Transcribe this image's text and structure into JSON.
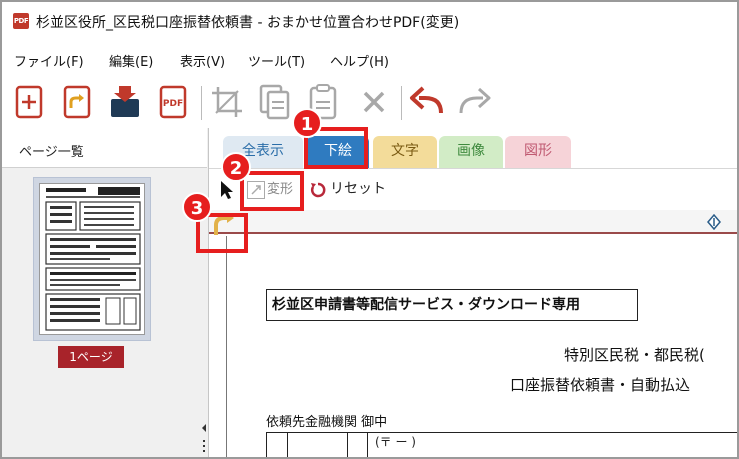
{
  "window": {
    "app_icon_text": "PDF",
    "title": "杉並区役所_区民税口座振替依頼書 - おまかせ位置合わせPDF(変更)"
  },
  "menu": [
    {
      "label": "ファイル(F)"
    },
    {
      "label": "編集(E)"
    },
    {
      "label": "表示(V)"
    },
    {
      "label": "ツール(T)"
    },
    {
      "label": "ヘルプ(H)"
    }
  ],
  "toolbar": {
    "items": [
      "new-file-icon",
      "open-file-icon",
      "import-icon",
      "pdf-export-icon",
      "crop-icon",
      "copy-icon",
      "paste-icon",
      "delete-icon",
      "undo-icon",
      "redo-icon"
    ]
  },
  "left_panel": {
    "title": "ページ一覧",
    "page_label": "1ページ",
    "splitter_glyph": "◀\n⋮"
  },
  "tabs": [
    {
      "label": "全表示",
      "bg": "#dfe9f2",
      "color": "#2a6da8"
    },
    {
      "label": "下絵",
      "bg": "#2f7bc0",
      "color": "#ffffff"
    },
    {
      "label": "文字",
      "bg": "#f3dc9a",
      "color": "#7a5a12"
    },
    {
      "label": "画像",
      "bg": "#d2ecc6",
      "color": "#3f8a3f"
    },
    {
      "label": "図形",
      "bg": "#f6d3d8",
      "color": "#c05a72"
    }
  ],
  "subtoolbar": {
    "transform_label": "変形",
    "reset_label": "リセット"
  },
  "document": {
    "heading": "杉並区申請書等配信サービス・ダウンロード専用",
    "line1": "特別区民税・都民税(",
    "line2": "口座振替依頼書・自動払込",
    "line3": "依頼先金融機関 御中",
    "postal": "(〒      ー          )"
  },
  "annotations": {
    "badge1": "1",
    "badge2": "2",
    "badge3": "3",
    "highlight_color": "#e61e1e"
  }
}
